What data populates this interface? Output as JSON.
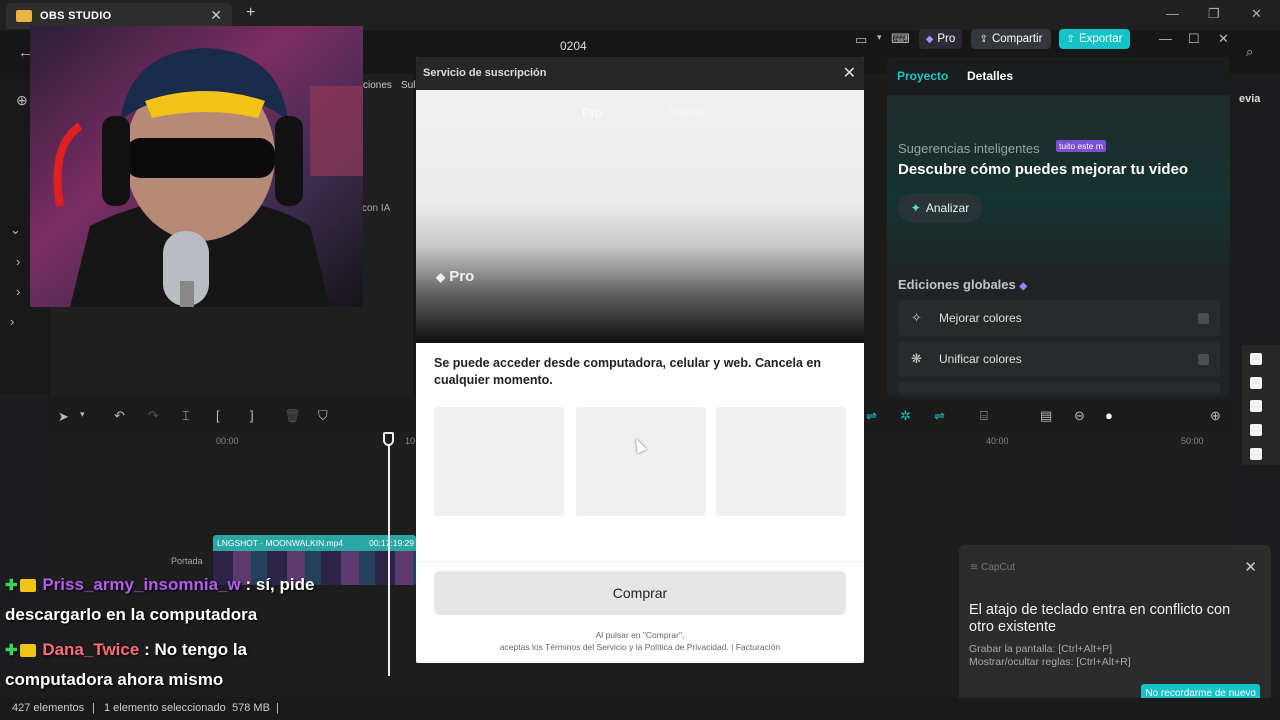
{
  "obs": {
    "tab_title": "OBS STUDIO",
    "tab_close": "✕",
    "new_tab": "+"
  },
  "capcut": {
    "project_title": "0204",
    "pro_label": "Pro",
    "share_label": "Compartir",
    "export_label": "Exportar",
    "left_partial": [
      "ciones",
      "Sul",
      "con IA"
    ]
  },
  "right_panel": {
    "tab_project": "Proyecto",
    "tab_details": "Detalles",
    "suggestions_title": "Sugerencias inteligentes",
    "suggestions_badge": "tuito este m",
    "suggestions_head": "Descubre cómo puedes mejorar tu video",
    "analyze_label": "Analizar",
    "global_edits_title": "Ediciones globales",
    "edits": [
      {
        "label": "Mejorar colores"
      },
      {
        "label": "Unificar colores"
      }
    ],
    "partial_right_text": "evia"
  },
  "timeline": {
    "ruler": [
      "00:00",
      "10",
      "40:00",
      "50:00"
    ],
    "clip_label": "LNGSHOT - MOONWALKIN.mp4",
    "clip_duration": "00:17:19:29",
    "cover_label": "Portada"
  },
  "modal": {
    "title": "Servicio de suscripción",
    "hero_tab_1": "Pro",
    "hero_tab_2": "Teams",
    "hero_badge": "Pro",
    "description": "Se puede acceder desde computadora, celular y web. Cancela en cualquier momento.",
    "buy_label": "Comprar",
    "legal_line1": "Al pulsar en \"Comprar\",",
    "legal_line2": "aceptas los Términos del Servicio y la Política de Privacidad. | Facturación"
  },
  "chat": [
    {
      "user": "Priss_army_insomnia_w",
      "message": ": sí, pide",
      "continuation": "descargarlo en la computadora"
    },
    {
      "user": "Dana_Twice",
      "message": ": No tengo la",
      "continuation": "computadora ahora mismo"
    }
  ],
  "toast": {
    "app": "CapCut",
    "heading": "El atajo de teclado entra en conflicto con otro existente",
    "line1": "Grabar la pantalla: [Ctrl+Alt+P]",
    "line2": "Mostrar/ocultar reglas: [Ctrl+Alt+R]",
    "button": "No recordarme de nuevo"
  },
  "statusbar": {
    "items_count": "427 elementos",
    "selected": "1 elemento seleccionado",
    "size": "578 MB"
  }
}
